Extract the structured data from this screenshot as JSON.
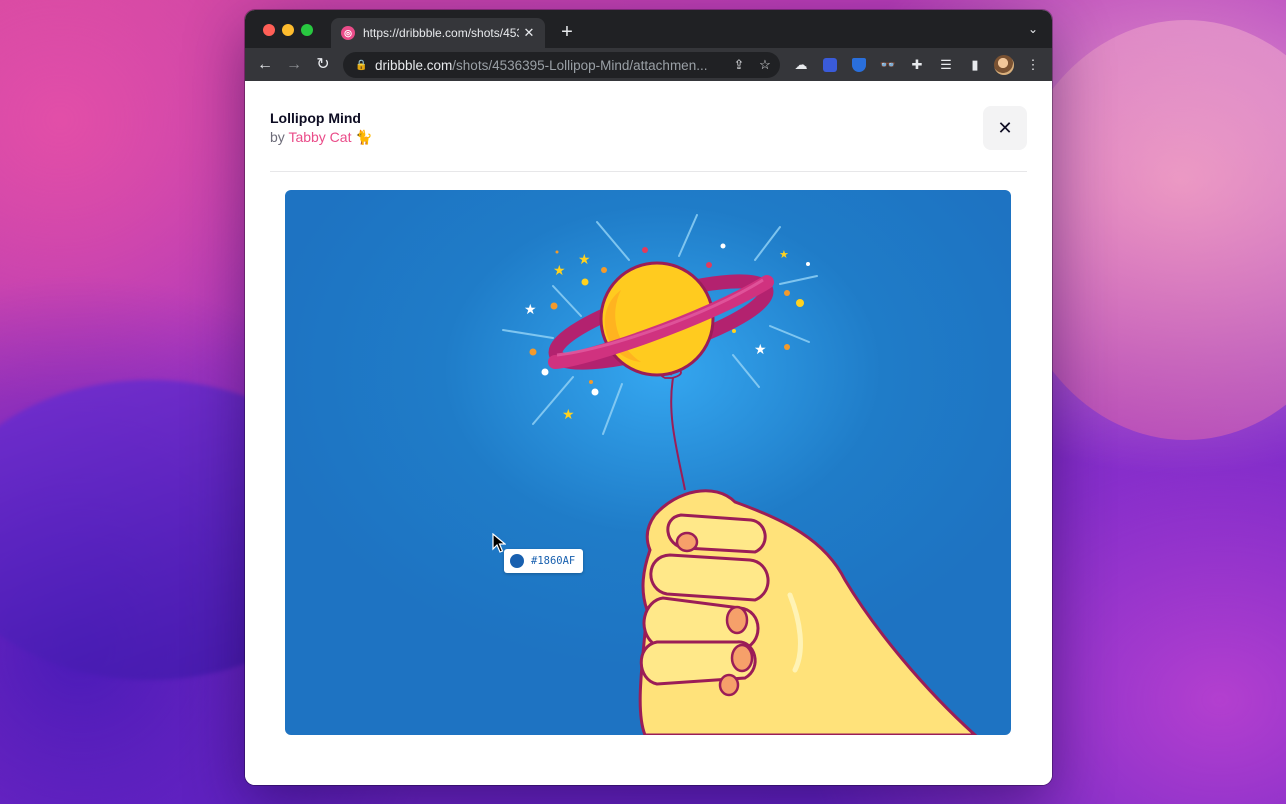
{
  "browser": {
    "tab": {
      "title": "https://dribbble.com/shots/453"
    },
    "address": {
      "host": "dribbble.com",
      "path": "/shots/4536395-Lollipop-Mind/attachmen..."
    }
  },
  "shot": {
    "title": "Lollipop Mind",
    "by_prefix": "by",
    "author": "Tabby Cat",
    "author_emoji": "🐈"
  },
  "color_picker": {
    "hex": "#1860AF",
    "swatch_color": "#1860AF"
  },
  "colors": {
    "dribbble_pink": "#ea4c89",
    "illustration_bg": "#1e73c2",
    "planet": "#ffcb1f",
    "ring": "#c2237c",
    "hand": "#ffe27a"
  }
}
